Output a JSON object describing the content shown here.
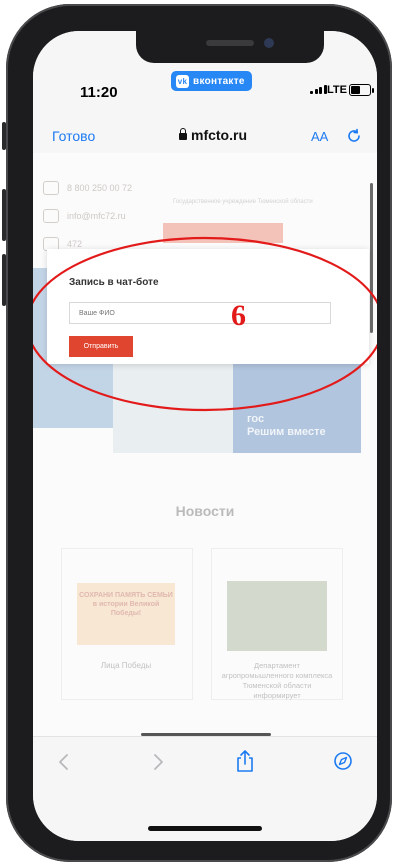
{
  "status_bar": {
    "time": "11:20",
    "carrier_badge": "вконтакте",
    "network": "LTE"
  },
  "browser": {
    "done_label": "Готово",
    "url": "mfcto.ru",
    "text_size_label": "AA"
  },
  "page": {
    "contacts": [
      "8 800 250 00 72",
      "info@mfc72.ru",
      "472"
    ],
    "header_note": "Государственное учреждение Тюменской области",
    "hero_text": [
      "гос",
      "Решим вместе"
    ],
    "news_title": "Новости",
    "news": [
      {
        "image_text": "СОХРАНИ ПАМЯТЬ СЕМЬИ в истории Великой Победы!",
        "caption": "Лица Победы"
      },
      {
        "caption": "Департамент агропромышленного комплекса Тюменской области информирует"
      }
    ]
  },
  "modal": {
    "title": "Запись в чат-боте",
    "name_placeholder": "Ваше ФИО",
    "submit_label": "Отправить"
  },
  "annotation": {
    "number": "6",
    "color": "#e31a1a"
  },
  "colors": {
    "accent_blue": "#1d7bf2",
    "button_red": "#e0452f",
    "vk_blue": "#2787f5"
  }
}
